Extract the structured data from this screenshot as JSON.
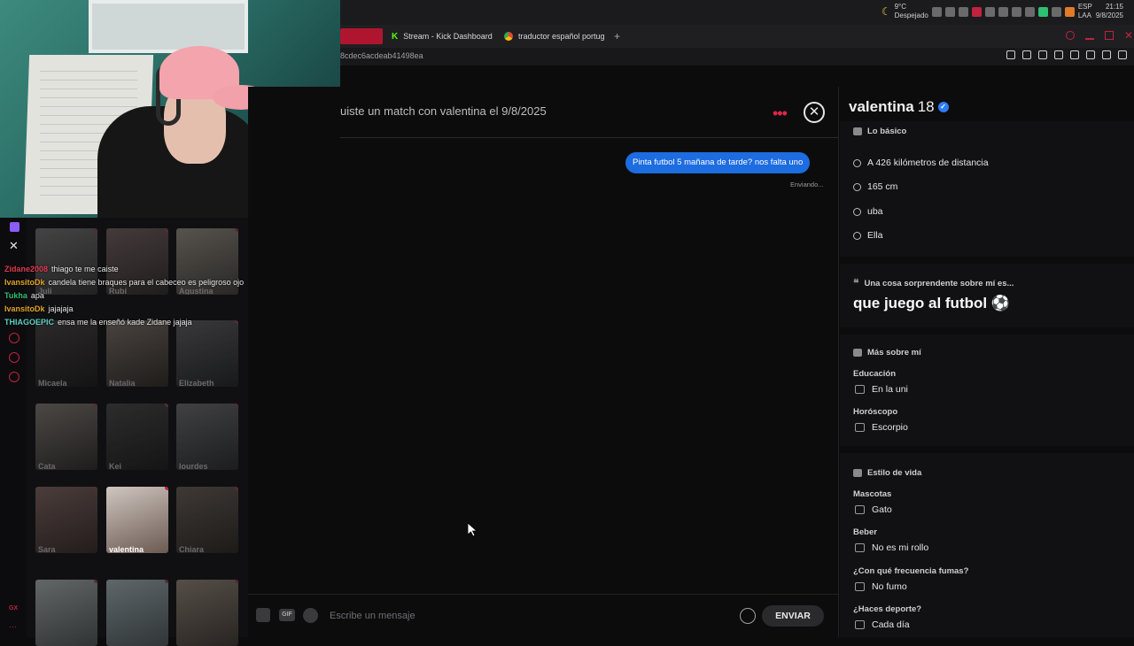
{
  "system_tray": {
    "weather_temp": "9°C",
    "weather_desc": "Despejado",
    "lang_top": "ESP",
    "lang_bottom": "LAA",
    "time": "21:15",
    "date": "9/8/2025"
  },
  "browser": {
    "tabs": [
      {
        "label": "Stream - Kick Dashboard"
      },
      {
        "label": "traductor español portug"
      }
    ],
    "new_tab_label": "+",
    "address_fragment": "8cdec6acdeab41498ea"
  },
  "chat_overlay": {
    "messages": [
      {
        "user": "Zidane2008",
        "text": "thiago te me caiste",
        "color": "#e23b51"
      },
      {
        "user": "IvansitoDk",
        "text": "candela tiene braques para el cabeceo es peligroso ojo",
        "color": "#e0a42a"
      },
      {
        "user": "Tukha",
        "text": "apa",
        "color": "#2fbf71"
      },
      {
        "user": "IvansitoDk",
        "text": "jajajaja",
        "color": "#e0a42a"
      },
      {
        "user": "THIAGOEPIC",
        "text": "ensa me la enseñó kade Zidane jajaja",
        "color": "#5fd1c4"
      }
    ],
    "close_label": "✕"
  },
  "matches": [
    {
      "name": "Juli"
    },
    {
      "name": "Rubi"
    },
    {
      "name": "Agustina"
    },
    {
      "name": "Micaela"
    },
    {
      "name": "Natalia"
    },
    {
      "name": "Elizabeth"
    },
    {
      "name": "Cata"
    },
    {
      "name": "Kei"
    },
    {
      "name": "lourdes"
    },
    {
      "name": "Sara"
    },
    {
      "name": "valentina"
    },
    {
      "name": "Chiara"
    },
    {
      "name": ""
    },
    {
      "name": ""
    },
    {
      "name": ""
    }
  ],
  "conversation": {
    "header": "uiste un match con valentina el 9/8/2025",
    "more_label": "•••",
    "close_label": "✕",
    "message": "Pinta futbol 5 mañana de tarde? nos falta uno",
    "status": "Enviando...",
    "input_placeholder": "Escribe un mensaje",
    "gif_label": "GIF",
    "send_label": "ENVIAR"
  },
  "profile": {
    "name": "valentina",
    "age": "18",
    "verified_mark": "✓",
    "basics_title": "Lo básico",
    "basics": [
      {
        "icon": "location-icon",
        "text": "A 426 kilómetros de distancia"
      },
      {
        "icon": "ruler-icon",
        "text": "165 cm"
      },
      {
        "icon": "school-icon",
        "text": "uba"
      },
      {
        "icon": "pronoun-icon",
        "text": "Ella"
      }
    ],
    "prompt_title": "Una cosa sorprendente sobre mí es...",
    "prompt_answer": "que juego al futbol ⚽",
    "more_title": "Más sobre mí",
    "more": [
      {
        "label": "Educación",
        "value": "En la uni"
      },
      {
        "label": "Horóscopo",
        "value": "Escorpio"
      }
    ],
    "lifestyle_title": "Estilo de vida",
    "lifestyle": [
      {
        "label": "Mascotas",
        "value": "Gato"
      },
      {
        "label": "Beber",
        "value": "No es mi rollo"
      },
      {
        "label": "¿Con qué frecuencia fumas?",
        "value": "No fumo"
      },
      {
        "label": "¿Haces deporte?",
        "value": "Cada día"
      }
    ]
  }
}
